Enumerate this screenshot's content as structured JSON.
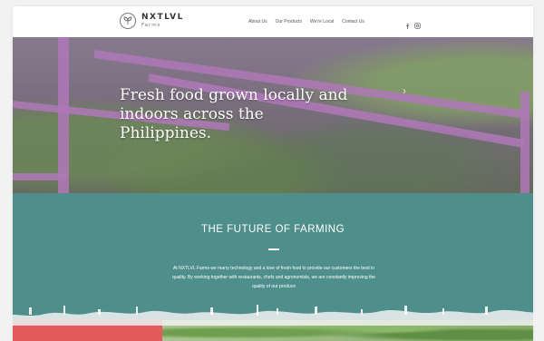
{
  "brand": {
    "name": "NXTLVL",
    "sub": "Farms"
  },
  "nav": {
    "items": [
      "About Us",
      "Our Products",
      "We're Local",
      "Contact Us"
    ]
  },
  "social": {
    "icons": [
      "facebook-icon",
      "instagram-icon"
    ]
  },
  "hero": {
    "title": "Fresh food grown locally and indoors across the Philippines.",
    "arrow": "›"
  },
  "future": {
    "title": "THE FUTURE OF FARMING",
    "body": "At NXTLVL Farms we marry technology and a love of fresh food to provide our customers the best in quality. By working together with restaurants, chefs and agronomists, we are constantly improving the quality of our produce"
  },
  "colors": {
    "teal": "#4e8f8c",
    "red": "#e55a5c",
    "pipe": "#d28cdc"
  }
}
